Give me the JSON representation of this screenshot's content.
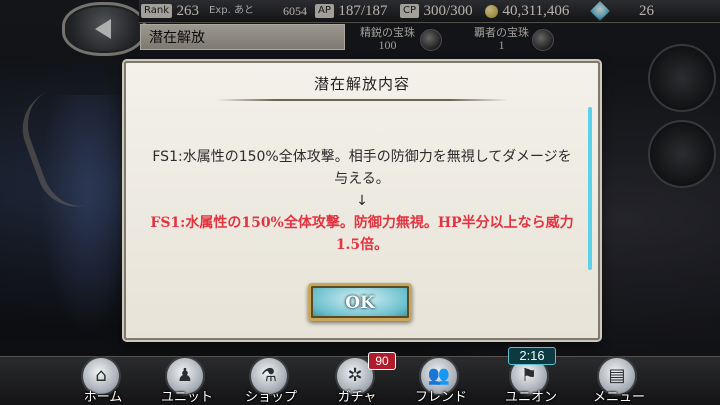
{
  "header": {
    "rank_label": "Rank",
    "rank_value": "263",
    "exp_label": "Exp. あと",
    "exp_value": "6054",
    "ap_label": "AP",
    "ap_value": "187/187",
    "cp_label": "CP",
    "cp_value": "300/300",
    "gold_value": "40,311,406",
    "gem_value": "26",
    "page_title": "潜在解放",
    "jewel_1_label": "精鋭の宝珠",
    "jewel_1_value": "100",
    "jewel_2_label": "覇者の宝珠",
    "jewel_2_value": "1"
  },
  "dialog": {
    "title": "潜在解放内容",
    "before_line1": "FS1:水属性の150%全体攻撃。相手の防御力を無視してダメージを",
    "before_line2": "与える。",
    "arrow": "↓",
    "after_line1": "FS1:水属性の150%全体攻撃。防御力無視。HP半分以上なら威力",
    "after_line2": "1.5倍。",
    "ok_label": "OK"
  },
  "nav": {
    "items": [
      {
        "label": "ホーム",
        "icon": "home-icon"
      },
      {
        "label": "ユニット",
        "icon": "unit-icon"
      },
      {
        "label": "ショップ",
        "icon": "shop-icon"
      },
      {
        "label": "ガチャ",
        "icon": "gacha-icon"
      },
      {
        "label": "フレンド",
        "icon": "friend-icon"
      },
      {
        "label": "ユニオン",
        "icon": "union-flag-icon"
      },
      {
        "label": "メニュー",
        "icon": "menu-icon"
      }
    ],
    "gacha_badge": "90",
    "union_timer": "2:16"
  },
  "colors": {
    "accent_red": "#e2333f",
    "scrollbar": "#59d2ea",
    "ok_button": "#6bbfcd"
  }
}
